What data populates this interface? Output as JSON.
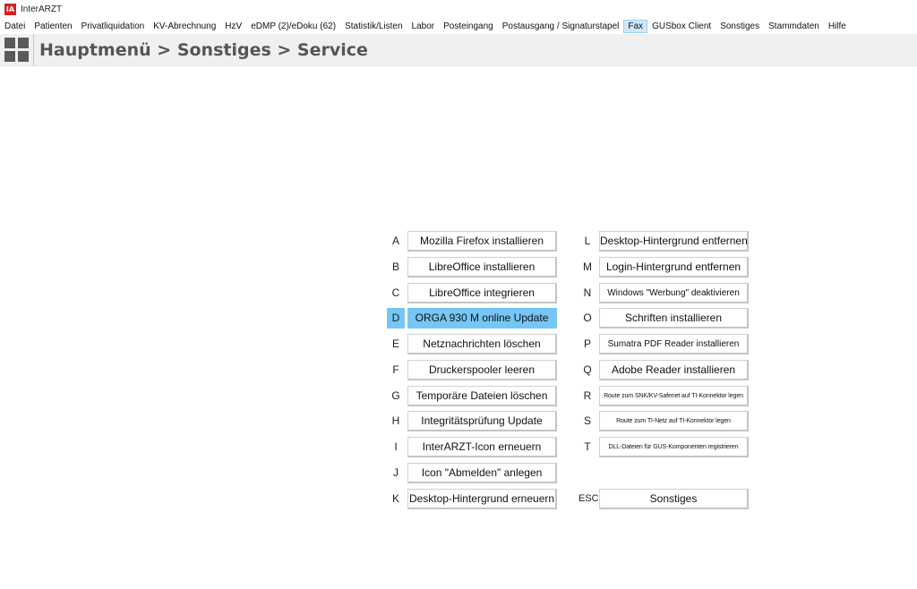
{
  "app": {
    "logo": "IA",
    "title": "InterARZT"
  },
  "menu": [
    "Datei",
    "Patienten",
    "Privatliquidation",
    "KV-Abrechnung",
    "HzV",
    "eDMP (2)/eDoku (62)",
    "Statistik/Listen",
    "Labor",
    "Posteingang",
    "Postausgang / Signaturstapel",
    "Fax",
    "GUSbox Client",
    "Sonstiges",
    "Stammdaten",
    "Hilfe"
  ],
  "active_menu": "Fax",
  "breadcrumb": "Hauptmenü > Sonstiges > Service",
  "colors": {
    "highlight": "#76c6f5",
    "logo_red": "#d42020",
    "breadcrumb_bg": "#f0f0f0"
  },
  "left_items": [
    {
      "key": "A",
      "label": "Mozilla Firefox installieren"
    },
    {
      "key": "B",
      "label": "LibreOffice installieren"
    },
    {
      "key": "C",
      "label": "LibreOffice integrieren"
    },
    {
      "key": "D",
      "label": "ORGA 930 M online Update",
      "selected": true
    },
    {
      "key": "E",
      "label": "Netznachrichten löschen"
    },
    {
      "key": "F",
      "label": "Druckerspooler leeren"
    },
    {
      "key": "G",
      "label": "Temporäre Dateien löschen"
    },
    {
      "key": "H",
      "label": "Integritätsprüfung Update"
    },
    {
      "key": "I",
      "label": "InterARZT-Icon erneuern"
    },
    {
      "key": "J",
      "label": "Icon \"Abmelden\" anlegen"
    },
    {
      "key": "K",
      "label": "Desktop-Hintergrund erneuern"
    }
  ],
  "right_items": [
    {
      "key": "L",
      "label": "Desktop-Hintergrund entfernen"
    },
    {
      "key": "M",
      "label": "Login-Hintergrund entfernen"
    },
    {
      "key": "N",
      "label": "Windows \"Werbung\" deaktivieren"
    },
    {
      "key": "O",
      "label": "Schriften installieren"
    },
    {
      "key": "P",
      "label": "Sumatra PDF Reader installieren"
    },
    {
      "key": "Q",
      "label": "Adobe Reader installieren"
    },
    {
      "key": "R",
      "label": "Route zum SNK/KV-Safenet auf TI-Konnektor legen"
    },
    {
      "key": "S",
      "label": "Route zum TI-Netz auf TI-Konnektor legen"
    },
    {
      "key": "T",
      "label": "DLL-Dateien für GUS-Komponenten registrieren"
    }
  ],
  "escape": {
    "key": "ESC",
    "label": "Sonstiges"
  }
}
